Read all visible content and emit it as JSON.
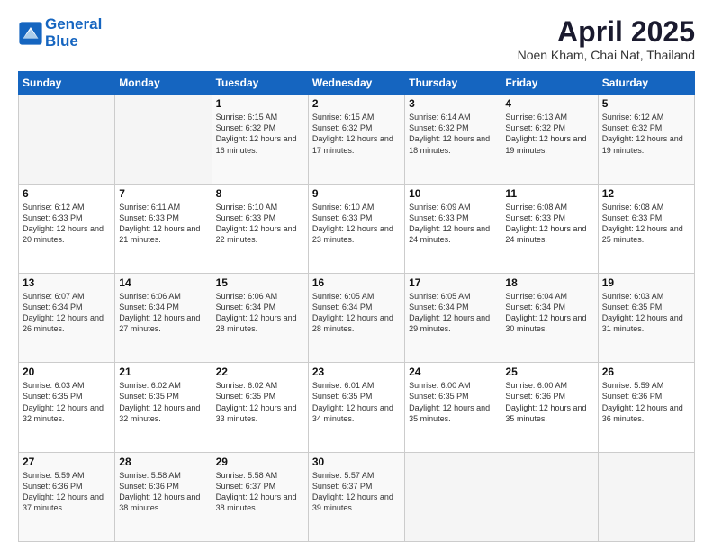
{
  "logo": {
    "line1": "General",
    "line2": "Blue"
  },
  "title": "April 2025",
  "subtitle": "Noen Kham, Chai Nat, Thailand",
  "days_of_week": [
    "Sunday",
    "Monday",
    "Tuesday",
    "Wednesday",
    "Thursday",
    "Friday",
    "Saturday"
  ],
  "weeks": [
    [
      {
        "day": "",
        "detail": ""
      },
      {
        "day": "",
        "detail": ""
      },
      {
        "day": "1",
        "detail": "Sunrise: 6:15 AM\nSunset: 6:32 PM\nDaylight: 12 hours and 16 minutes."
      },
      {
        "day": "2",
        "detail": "Sunrise: 6:15 AM\nSunset: 6:32 PM\nDaylight: 12 hours and 17 minutes."
      },
      {
        "day": "3",
        "detail": "Sunrise: 6:14 AM\nSunset: 6:32 PM\nDaylight: 12 hours and 18 minutes."
      },
      {
        "day": "4",
        "detail": "Sunrise: 6:13 AM\nSunset: 6:32 PM\nDaylight: 12 hours and 19 minutes."
      },
      {
        "day": "5",
        "detail": "Sunrise: 6:12 AM\nSunset: 6:32 PM\nDaylight: 12 hours and 19 minutes."
      }
    ],
    [
      {
        "day": "6",
        "detail": "Sunrise: 6:12 AM\nSunset: 6:33 PM\nDaylight: 12 hours and 20 minutes."
      },
      {
        "day": "7",
        "detail": "Sunrise: 6:11 AM\nSunset: 6:33 PM\nDaylight: 12 hours and 21 minutes."
      },
      {
        "day": "8",
        "detail": "Sunrise: 6:10 AM\nSunset: 6:33 PM\nDaylight: 12 hours and 22 minutes."
      },
      {
        "day": "9",
        "detail": "Sunrise: 6:10 AM\nSunset: 6:33 PM\nDaylight: 12 hours and 23 minutes."
      },
      {
        "day": "10",
        "detail": "Sunrise: 6:09 AM\nSunset: 6:33 PM\nDaylight: 12 hours and 24 minutes."
      },
      {
        "day": "11",
        "detail": "Sunrise: 6:08 AM\nSunset: 6:33 PM\nDaylight: 12 hours and 24 minutes."
      },
      {
        "day": "12",
        "detail": "Sunrise: 6:08 AM\nSunset: 6:33 PM\nDaylight: 12 hours and 25 minutes."
      }
    ],
    [
      {
        "day": "13",
        "detail": "Sunrise: 6:07 AM\nSunset: 6:34 PM\nDaylight: 12 hours and 26 minutes."
      },
      {
        "day": "14",
        "detail": "Sunrise: 6:06 AM\nSunset: 6:34 PM\nDaylight: 12 hours and 27 minutes."
      },
      {
        "day": "15",
        "detail": "Sunrise: 6:06 AM\nSunset: 6:34 PM\nDaylight: 12 hours and 28 minutes."
      },
      {
        "day": "16",
        "detail": "Sunrise: 6:05 AM\nSunset: 6:34 PM\nDaylight: 12 hours and 28 minutes."
      },
      {
        "day": "17",
        "detail": "Sunrise: 6:05 AM\nSunset: 6:34 PM\nDaylight: 12 hours and 29 minutes."
      },
      {
        "day": "18",
        "detail": "Sunrise: 6:04 AM\nSunset: 6:34 PM\nDaylight: 12 hours and 30 minutes."
      },
      {
        "day": "19",
        "detail": "Sunrise: 6:03 AM\nSunset: 6:35 PM\nDaylight: 12 hours and 31 minutes."
      }
    ],
    [
      {
        "day": "20",
        "detail": "Sunrise: 6:03 AM\nSunset: 6:35 PM\nDaylight: 12 hours and 32 minutes."
      },
      {
        "day": "21",
        "detail": "Sunrise: 6:02 AM\nSunset: 6:35 PM\nDaylight: 12 hours and 32 minutes."
      },
      {
        "day": "22",
        "detail": "Sunrise: 6:02 AM\nSunset: 6:35 PM\nDaylight: 12 hours and 33 minutes."
      },
      {
        "day": "23",
        "detail": "Sunrise: 6:01 AM\nSunset: 6:35 PM\nDaylight: 12 hours and 34 minutes."
      },
      {
        "day": "24",
        "detail": "Sunrise: 6:00 AM\nSunset: 6:35 PM\nDaylight: 12 hours and 35 minutes."
      },
      {
        "day": "25",
        "detail": "Sunrise: 6:00 AM\nSunset: 6:36 PM\nDaylight: 12 hours and 35 minutes."
      },
      {
        "day": "26",
        "detail": "Sunrise: 5:59 AM\nSunset: 6:36 PM\nDaylight: 12 hours and 36 minutes."
      }
    ],
    [
      {
        "day": "27",
        "detail": "Sunrise: 5:59 AM\nSunset: 6:36 PM\nDaylight: 12 hours and 37 minutes."
      },
      {
        "day": "28",
        "detail": "Sunrise: 5:58 AM\nSunset: 6:36 PM\nDaylight: 12 hours and 38 minutes."
      },
      {
        "day": "29",
        "detail": "Sunrise: 5:58 AM\nSunset: 6:37 PM\nDaylight: 12 hours and 38 minutes."
      },
      {
        "day": "30",
        "detail": "Sunrise: 5:57 AM\nSunset: 6:37 PM\nDaylight: 12 hours and 39 minutes."
      },
      {
        "day": "",
        "detail": ""
      },
      {
        "day": "",
        "detail": ""
      },
      {
        "day": "",
        "detail": ""
      }
    ]
  ]
}
